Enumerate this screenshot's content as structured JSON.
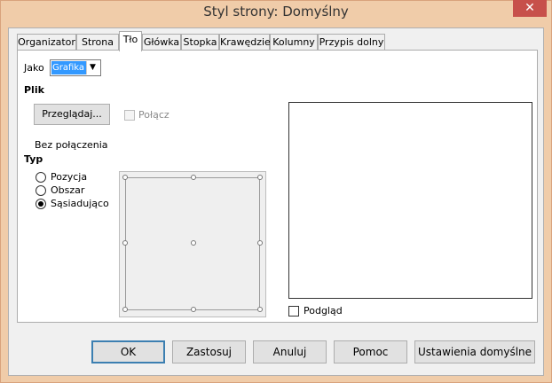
{
  "window": {
    "title": "Styl strony: Domyślny",
    "close_glyph": "✕"
  },
  "tabs": [
    {
      "label": "Organizator"
    },
    {
      "label": "Strona"
    },
    {
      "label": "Tło"
    },
    {
      "label": "Główka"
    },
    {
      "label": "Stopka"
    },
    {
      "label": "Krawędzie"
    },
    {
      "label": "Kolumny"
    },
    {
      "label": "Przypis dolny"
    }
  ],
  "panel": {
    "as_label": "Jako",
    "as_value": "Grafika",
    "file_header": "Plik",
    "browse_label": "Przeglądaj...",
    "link_label": "Połącz",
    "link_checked": false,
    "link_status": "Bez połączenia",
    "type_header": "Typ",
    "types": [
      {
        "label": "Pozycja",
        "selected": false
      },
      {
        "label": "Obszar",
        "selected": false
      },
      {
        "label": "Sąsiadująco",
        "selected": true
      }
    ],
    "preview_label": "Podgląd",
    "preview_checked": false
  },
  "buttons": {
    "ok": "OK",
    "apply": "Zastosuj",
    "cancel": "Anuluj",
    "help": "Pomoc",
    "reset": "Ustawienia domyślne"
  },
  "colors": {
    "titlebar": "#f0cca9",
    "close": "#c7504b",
    "selection": "#3399ff"
  }
}
